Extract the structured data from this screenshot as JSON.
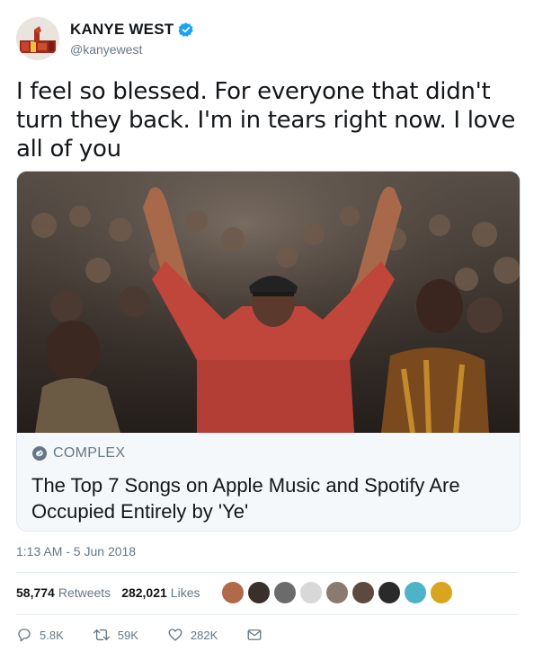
{
  "author": {
    "display_name": "KANYE WEST",
    "handle": "@kanyewest",
    "avatar_icon": "profile-avatar",
    "verified_icon": "verified-badge-icon",
    "verified_color": "#1da1f2"
  },
  "tweet": {
    "text": "I feel so blessed.  For everyone that didn't turn they back. I'm in tears right now. I love all of you",
    "timestamp": "1:13 AM - 5 Jun 2018"
  },
  "card": {
    "source": "COMPLEX",
    "source_icon": "link-icon",
    "title": "The Top 7 Songs on Apple Music and Spotify Are Occupied Entirely by 'Ye'"
  },
  "stats": {
    "retweets_count": "58,774",
    "retweets_label": "Retweets",
    "likes_count": "282,021",
    "likes_label": "Likes"
  },
  "likers": [
    "#b06a4a",
    "#3a2f2a",
    "#6b6b6b",
    "#d8d8d8",
    "#8a7a70",
    "#5a4a40",
    "#2a2a2a",
    "#4fb3c8",
    "#d9a520"
  ],
  "actions": {
    "reply_count": "5.8K",
    "retweet_count": "59K",
    "like_count": "282K"
  }
}
